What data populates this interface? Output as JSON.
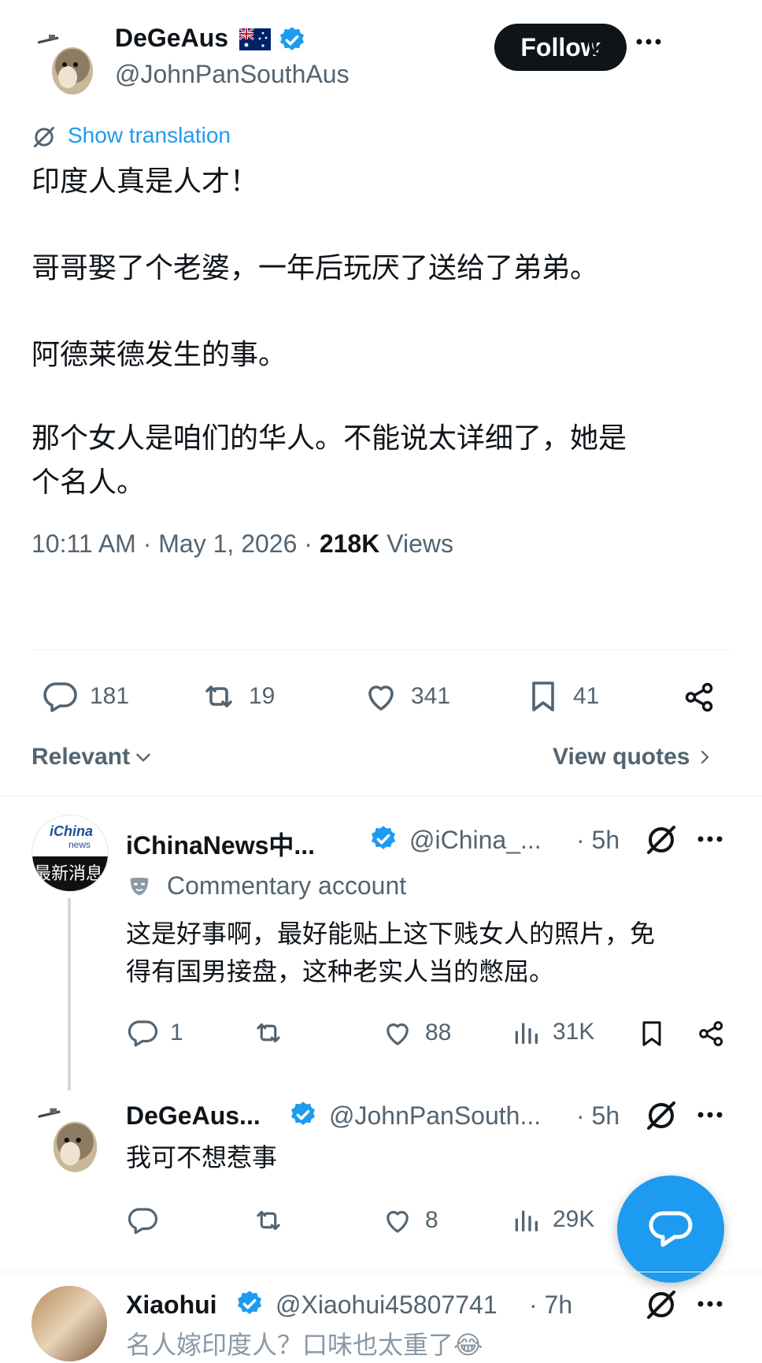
{
  "post": {
    "author_name": "DeGeAus",
    "handle": "@JohnPanSouthAus",
    "follow_label": "Follow",
    "show_translation": "Show translation",
    "lines": [
      "印度人真是人才！",
      "哥哥娶了个老婆，一年后玩厌了送给了弟弟。",
      "阿德莱德发生的事。",
      "那个女人是咱们的华人。不能说太详细了，她是",
      "个名人。"
    ],
    "time_date": "10:11 AM · May 1, 2026 · ",
    "views_count": "218K",
    "views_label": " Views",
    "stats": {
      "replies": "181",
      "reposts": "19",
      "likes": "341",
      "bookmarks": "41"
    },
    "colors": {
      "verified": "#1d9bf0",
      "text": "#0f1419",
      "muted": "#536471"
    }
  },
  "sort": {
    "relevant_label": "Relevant",
    "view_quotes_label": "View quotes"
  },
  "replies": [
    {
      "avatar_text_top": "iChina",
      "avatar_text_small": "news",
      "avatar_text_bottom": "最新消息",
      "name": "iChinaNews中...",
      "handle": "@iChina_...",
      "time": "· 5h",
      "label_badge": "Commentary account",
      "lines": [
        "这是好事啊，最好能贴上这下贱女人的照片，免",
        "得有国男接盘，这种老实人当的憋屈。"
      ],
      "stats": {
        "replies": "1",
        "reposts": "",
        "likes": "88",
        "views": "31K"
      }
    },
    {
      "name": "DeGeAus...",
      "handle": "@JohnPanSouth...",
      "time": "· 5h",
      "lines": [
        "我可不想惹事"
      ],
      "stats": {
        "replies": "",
        "reposts": "",
        "likes": "8",
        "views": "29K"
      }
    },
    {
      "name": "Xiaohui",
      "handle": "@Xiaohui45807741",
      "time": "· 7h",
      "lines": [
        "名人嫁印度人？口味也太重了😂"
      ]
    }
  ]
}
